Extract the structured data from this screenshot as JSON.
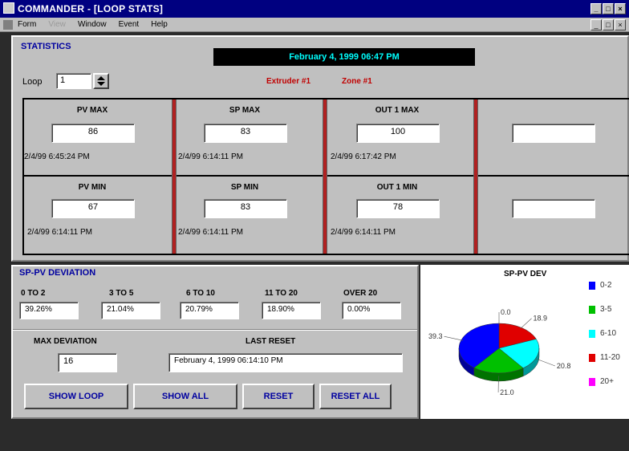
{
  "window": {
    "title": "COMMANDER - [LOOP STATS]",
    "controls": [
      "_",
      "□",
      "×"
    ]
  },
  "menu": {
    "items": [
      {
        "label": "Form",
        "disabled": false
      },
      {
        "label": "View",
        "disabled": true
      },
      {
        "label": "Window",
        "disabled": false
      },
      {
        "label": "Event",
        "disabled": false
      },
      {
        "label": "Help",
        "disabled": false
      }
    ]
  },
  "statistics": {
    "title": "STATISTICS",
    "datetime": "February 4, 1999 06:47 PM",
    "loop_label": "Loop",
    "loop_value": "1",
    "extruder": "Extruder #1",
    "zone": "Zone #1",
    "max_row": [
      {
        "title": "PV MAX",
        "value": "86",
        "time": "2/4/99 6:45:24 PM"
      },
      {
        "title": "SP MAX",
        "value": "83",
        "time": "2/4/99 6:14:11 PM"
      },
      {
        "title": "OUT 1 MAX",
        "value": "100",
        "time": "2/4/99 6:17:42 PM"
      },
      {
        "title": "",
        "value": "",
        "time": ""
      }
    ],
    "min_row": [
      {
        "title": "PV MIN",
        "value": "67",
        "time": "2/4/99 6:14:11 PM"
      },
      {
        "title": "SP MIN",
        "value": "83",
        "time": "2/4/99 6:14:11 PM"
      },
      {
        "title": "OUT 1 MIN",
        "value": "78",
        "time": "2/4/99 6:14:11 PM"
      },
      {
        "title": "",
        "value": "",
        "time": ""
      }
    ]
  },
  "deviation": {
    "title": "SP-PV DEVIATION",
    "buckets": [
      {
        "label": "0 TO 2",
        "value": "39.26%"
      },
      {
        "label": "3 TO 5",
        "value": "21.04%"
      },
      {
        "label": "6 TO 10",
        "value": "20.79%"
      },
      {
        "label": "11 TO 20",
        "value": "18.90%"
      },
      {
        "label": "OVER 20",
        "value": "0.00%"
      }
    ],
    "max_label": "MAX DEVIATION",
    "max_value": "16",
    "reset_label": "LAST RESET",
    "reset_value": "February 4, 1999 06:14:10 PM",
    "buttons": {
      "show_loop": "SHOW LOOP",
      "show_all": "SHOW ALL",
      "reset": "RESET",
      "reset_all": "RESET ALL"
    }
  },
  "chart_data": {
    "type": "pie",
    "title": "SP-PV DEV",
    "categories": [
      "0-2",
      "3-5",
      "6-10",
      "11-20",
      "20+"
    ],
    "values": [
      39.3,
      21.0,
      20.8,
      18.9,
      0.0
    ],
    "value_labels": [
      "39.3",
      "21.0",
      "20.8",
      "18.9",
      "0.0"
    ],
    "colors": [
      "#0000ff",
      "#00c000",
      "#00ffff",
      "#e00000",
      "#ff00ff"
    ],
    "legend_position": "right"
  }
}
